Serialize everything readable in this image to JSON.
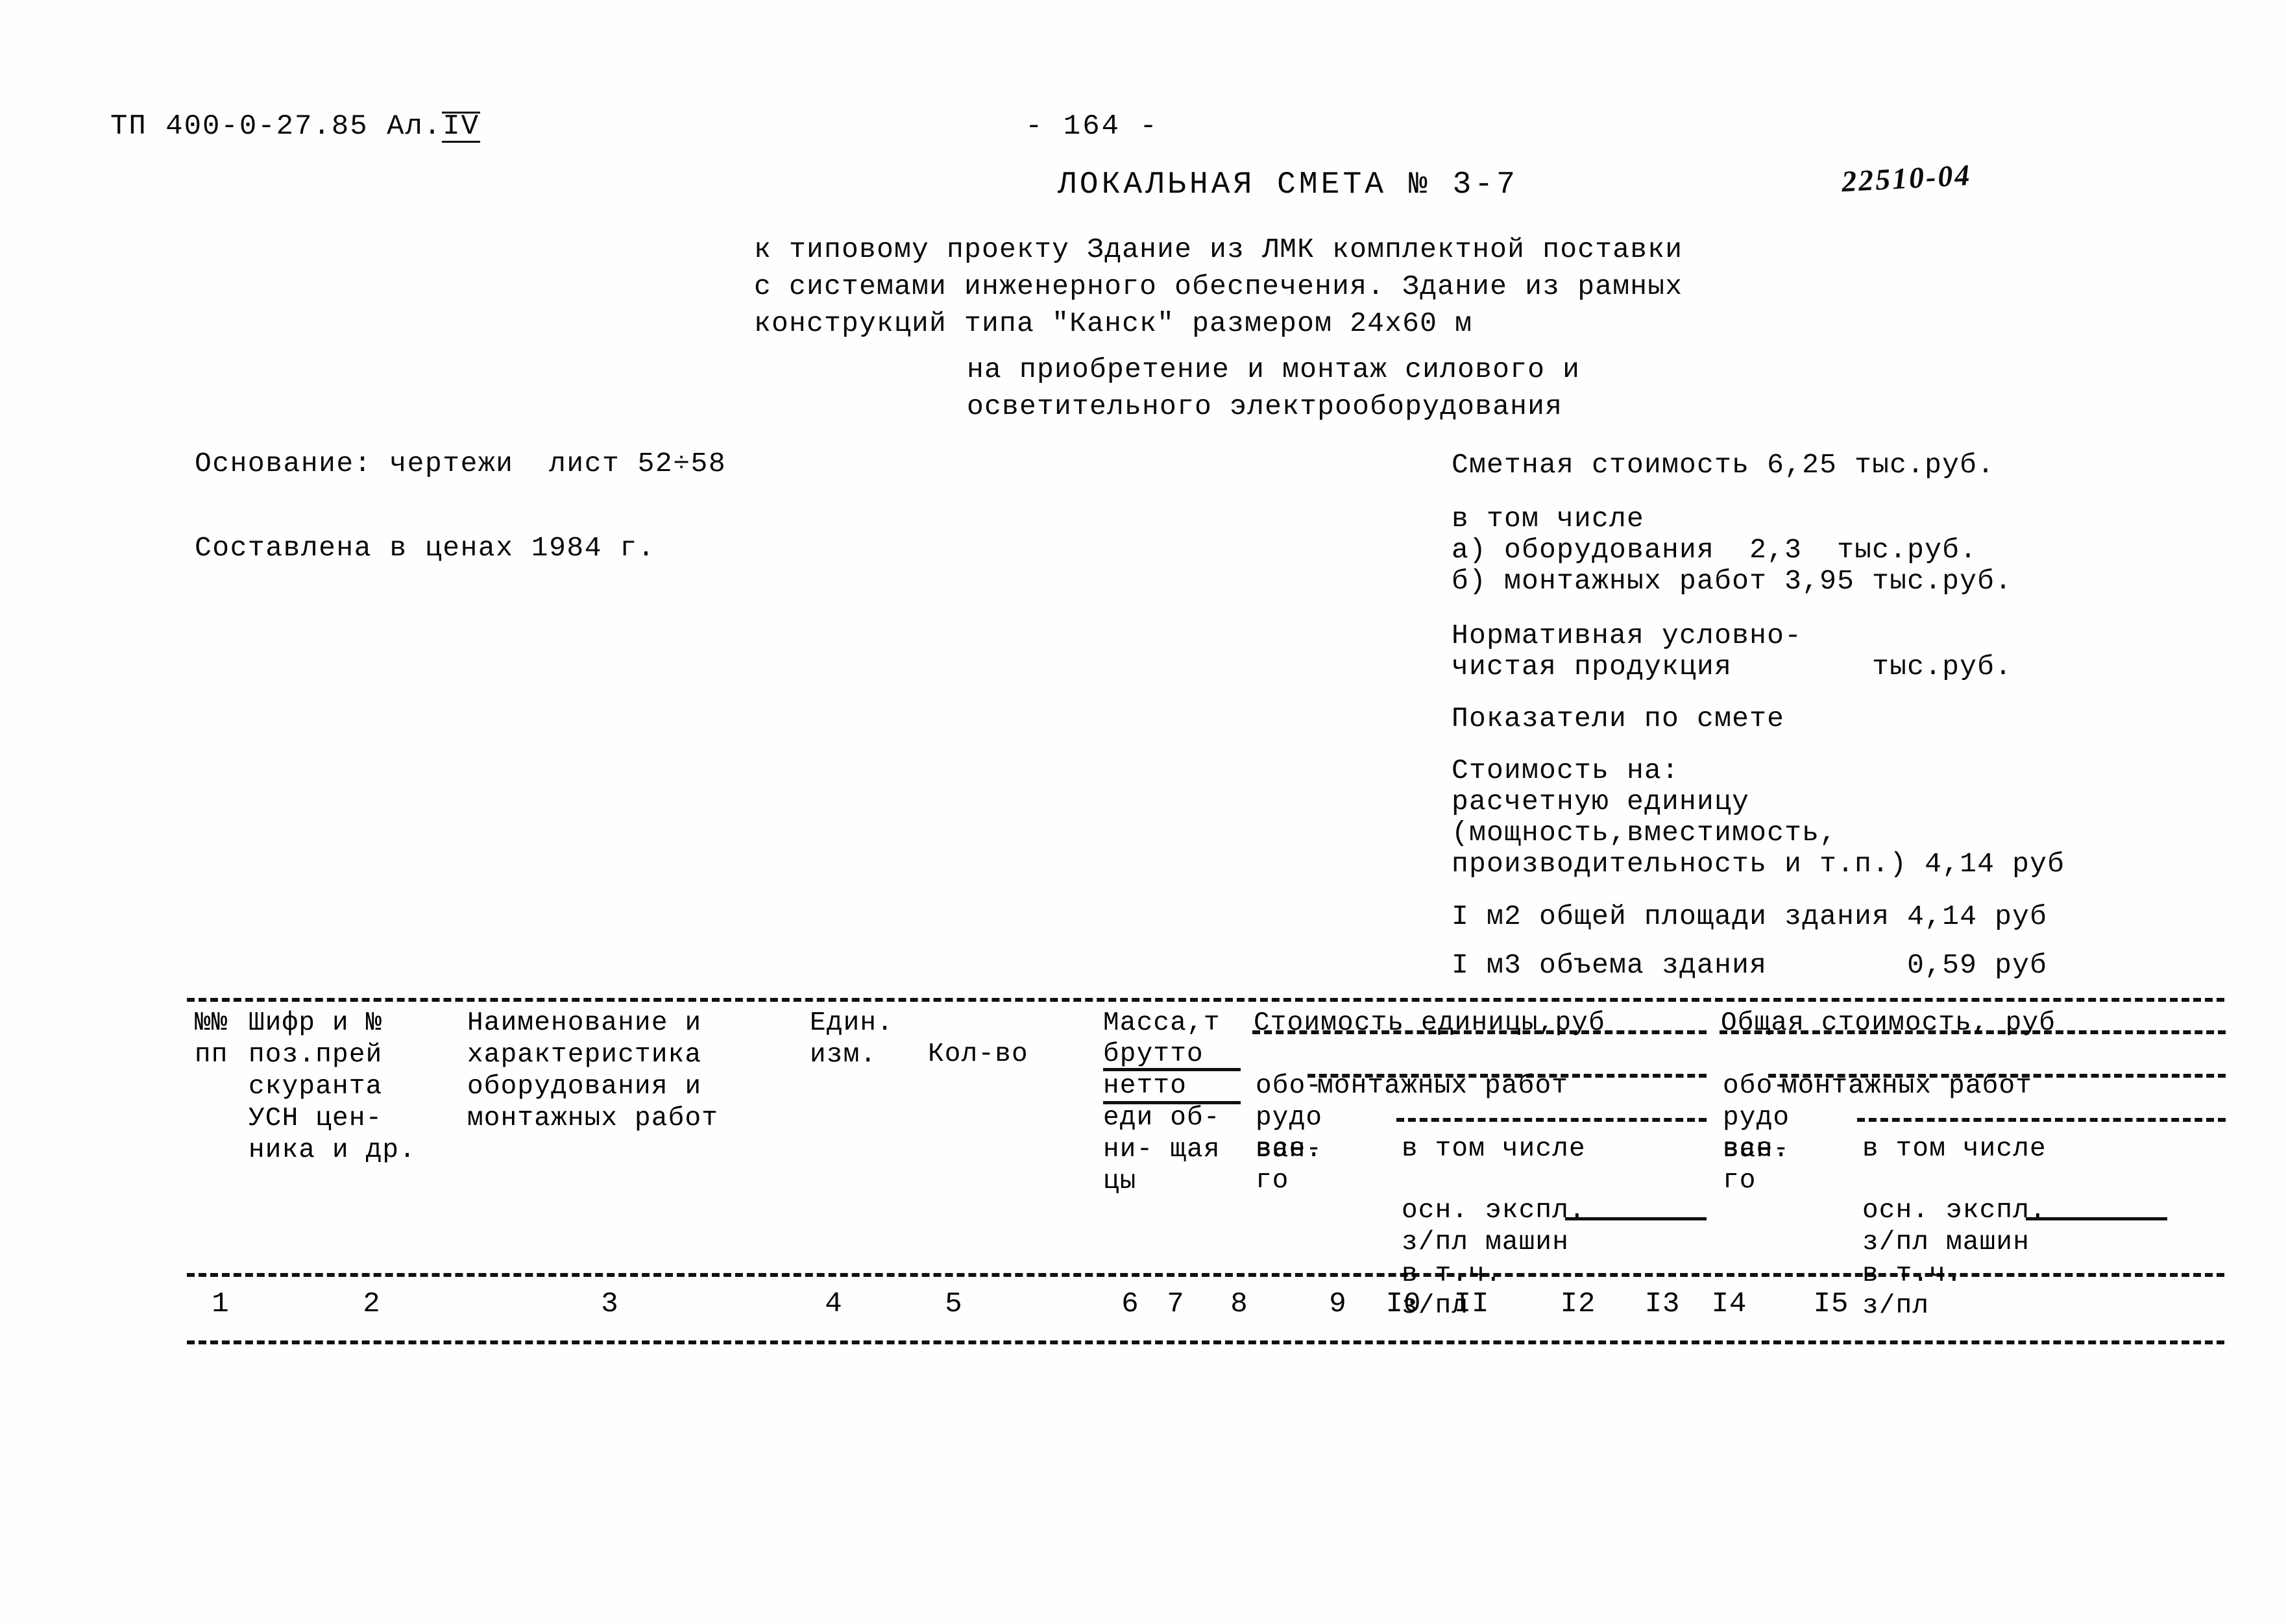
{
  "header": {
    "doc_code_prefix": "ТП 400-0-27.85 Ал.",
    "doc_code_album": "IV",
    "page_number": "- 164 -",
    "archive_stamp": "22510-04",
    "title": "ЛОКАЛЬНАЯ СМЕТА № 3-7",
    "subtitle_lines": [
      "к типовому проекту Здание из ЛМК комплектной поставки",
      "с системами инженерного обеспечения. Здание из рамных",
      "конструкций типа \"Канск\" размером 24х60 м",
      "на приобретение и монтаж силового и",
      "осветительного электрооборудования"
    ]
  },
  "left_info": {
    "basis": "Основание: чертежи  лист 52÷58",
    "prices": "Составлена в ценах 1984 г."
  },
  "right_info": {
    "total_cost": "Сметная стоимость 6,25 тыс.руб.",
    "including": "в том числе",
    "item_a": "а) оборудования  2,3  тыс.руб.",
    "item_b": "б) монтажных работ 3,95 тыс.руб.",
    "normative_line1": "Нормативная условно-",
    "normative_line2": "чистая продукция        тыс.руб.",
    "indicators": "Показатели по смете",
    "cost_on": "Стоимость на:",
    "unit": "расчетную единицу",
    "capacity": "(мощность,вместимость,",
    "performance": "производительность и т.п.) 4,14 руб",
    "per_m2": "I м2 общей площади здания 4,14 руб",
    "per_m3": "I м3 объема здания        0,59 руб"
  },
  "table": {
    "headers": {
      "col1": "№№\nпп",
      "col2": "Шифр и №\nпоз.прей\nскуранта\nУСН цен-\nника и др.",
      "col3": "Наименование и\nхарактеристика\nоборудования и\nмонтажных работ",
      "col4": "Един.\nизм.",
      "col5": "Кол-во",
      "col6_title": "Масса,т",
      "col6_rows": "брутто\nнетто\nеди об-\nни- щая\nцы",
      "group_unit_cost": "Стоимость единицы,руб",
      "group_total_cost": "Общая стоимость, руб",
      "equipment": "обо-\nрудо\nван.",
      "mounting_works": "монтажных работ",
      "vsego": "все-\nго",
      "v_tom_chisle": "в том числе",
      "osn_expl": "осн. экспл.\nз/пл машин\nв т.ч.\nз/пл"
    },
    "column_numbers": [
      "1",
      "2",
      "3",
      "4",
      "5",
      "6",
      "7",
      "8",
      "9",
      "I0",
      "II",
      "I2",
      "I3",
      "I4",
      "I5"
    ],
    "column_number_x": [
      340,
      573,
      940,
      1285,
      1470,
      1742,
      1812,
      1910,
      2062,
      2163,
      2268,
      2432,
      2562,
      2665,
      2822
    ]
  }
}
